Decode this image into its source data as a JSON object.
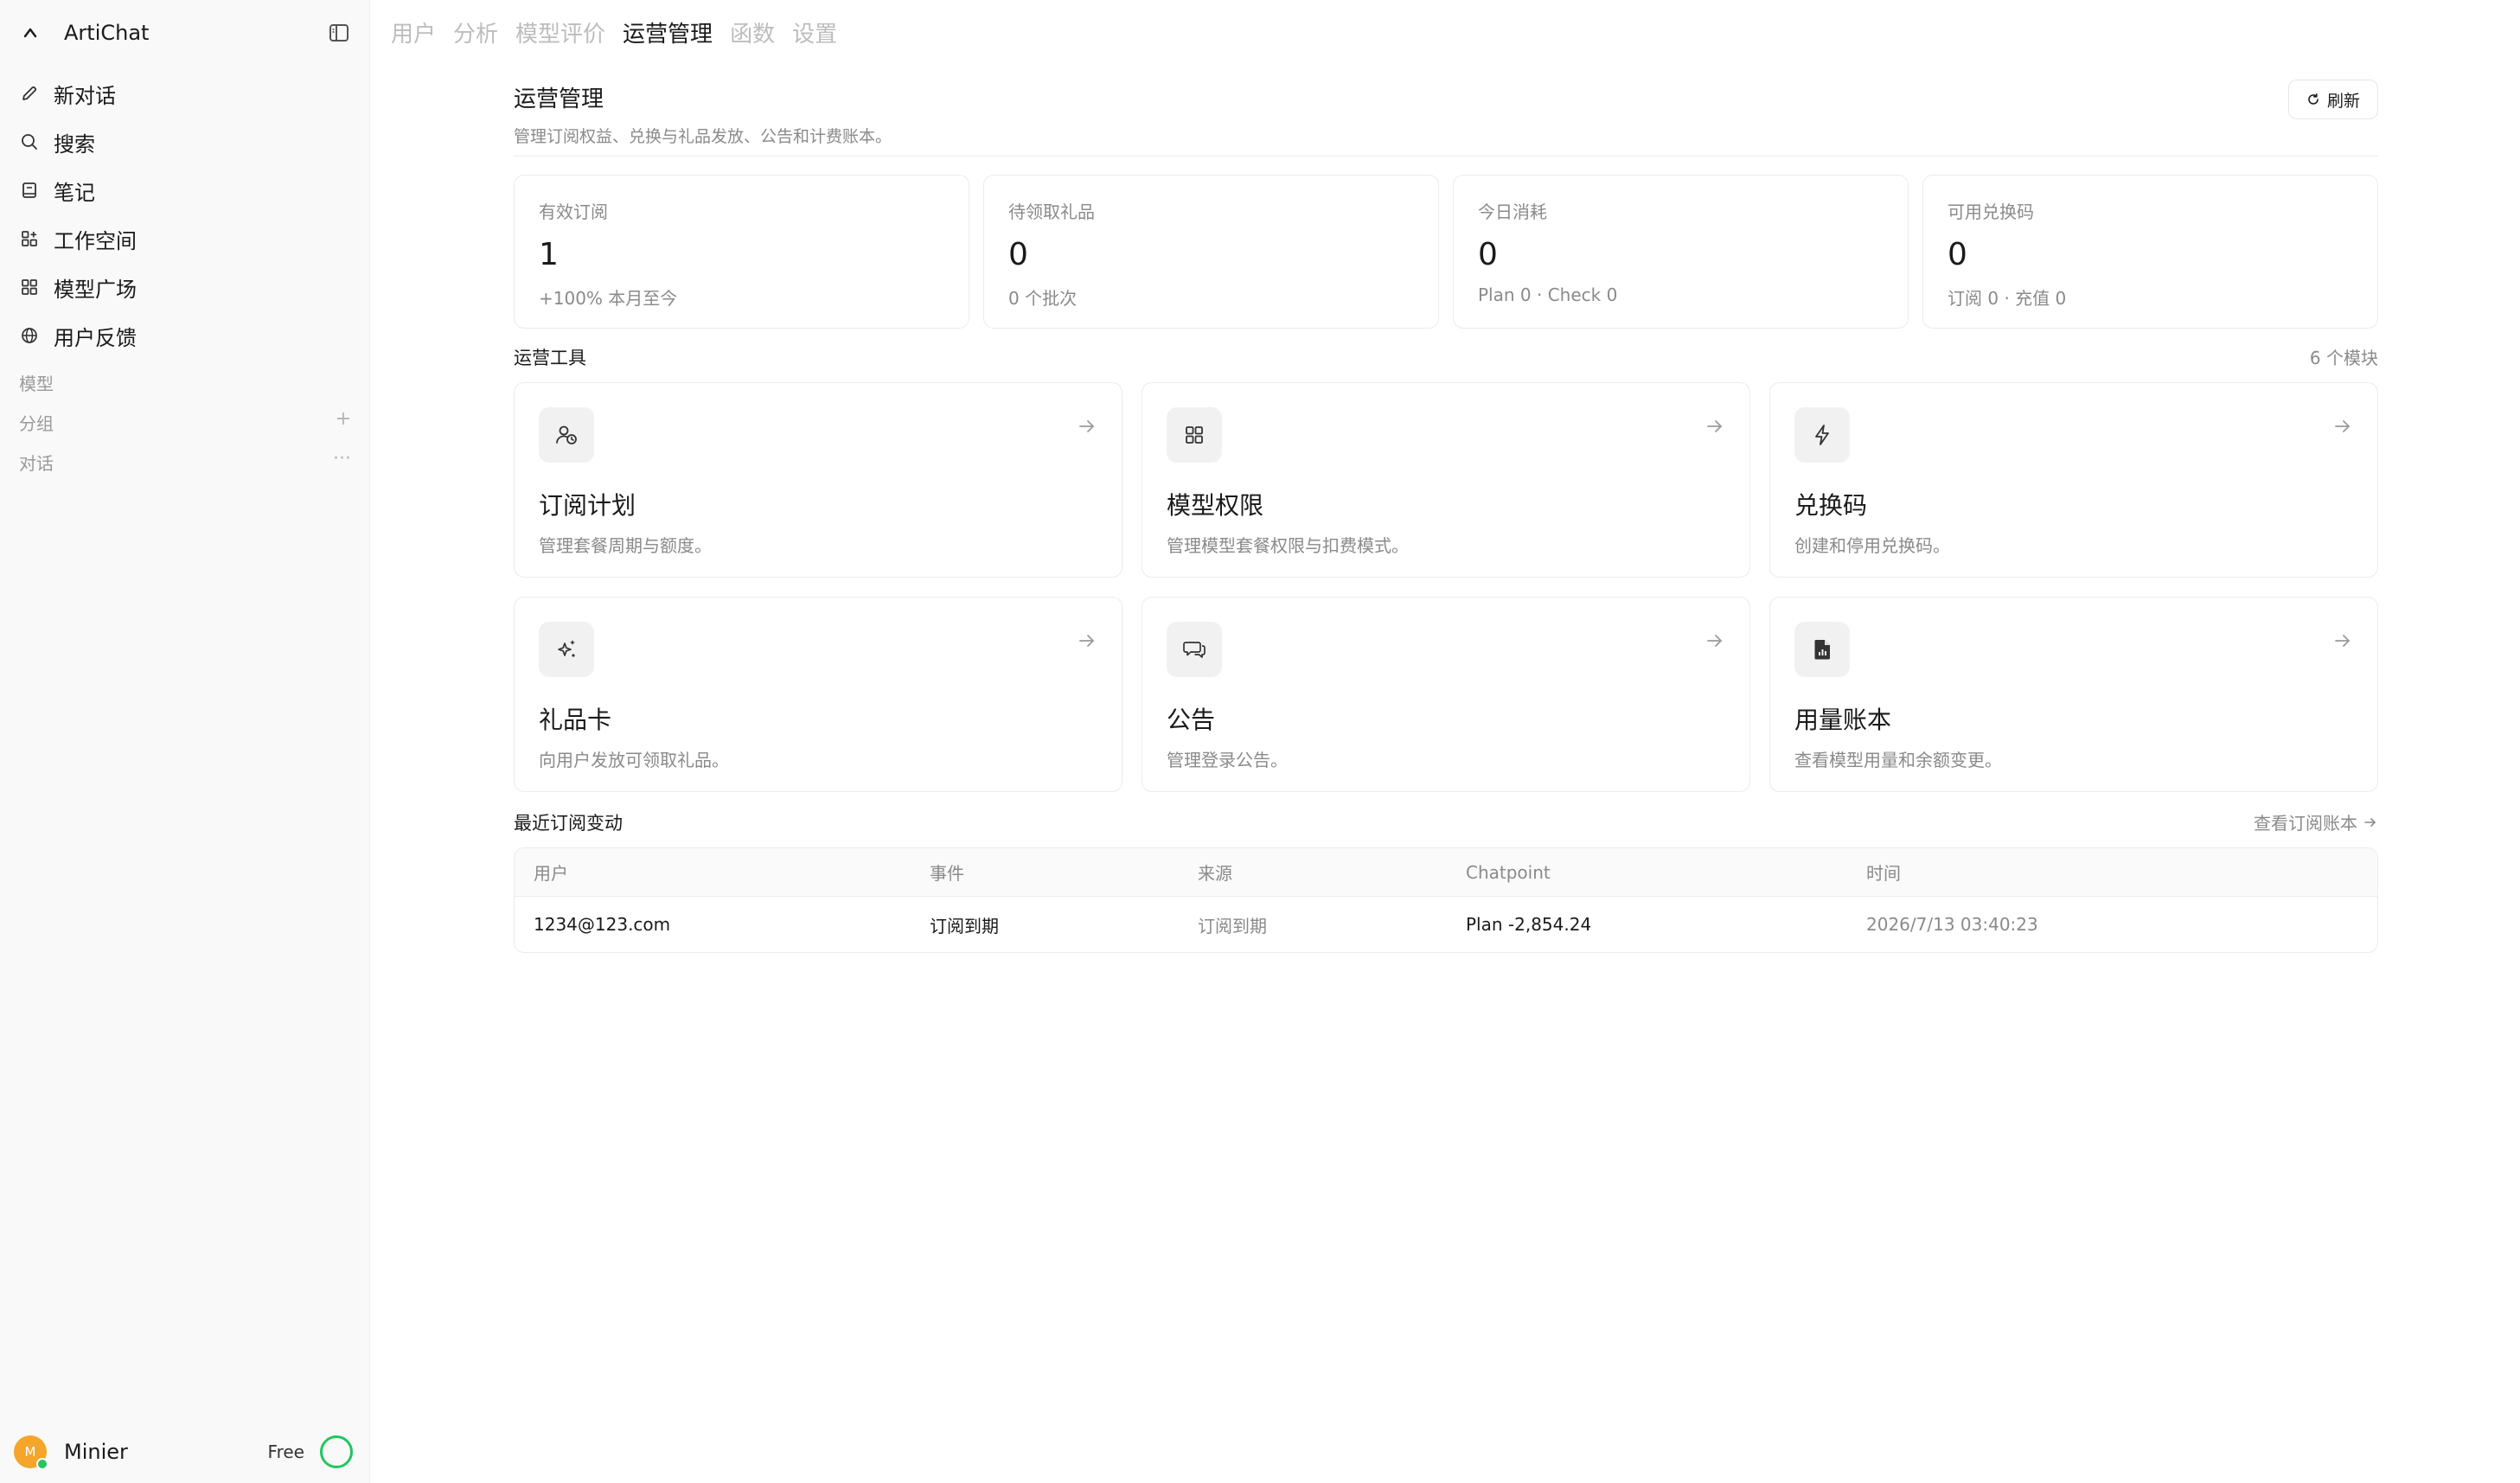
{
  "app": {
    "name": "ArtiChat"
  },
  "sidebar": {
    "items": [
      {
        "label": "新对话",
        "icon": "pencil-icon"
      },
      {
        "label": "搜索",
        "icon": "search-icon"
      },
      {
        "label": "笔记",
        "icon": "notebook-icon"
      },
      {
        "label": "工作空间",
        "icon": "workspace-icon"
      },
      {
        "label": "模型广场",
        "icon": "grid-icon"
      },
      {
        "label": "用户反馈",
        "icon": "globe-icon"
      }
    ],
    "sections": {
      "models": "模型",
      "groups": "分组",
      "groups_action": "+",
      "chats": "对话",
      "chats_action": "···"
    },
    "user": {
      "initial": "M",
      "name": "Minier",
      "plan": "Free"
    }
  },
  "tabs": [
    "用户",
    "分析",
    "模型评价",
    "运营管理",
    "函数",
    "设置"
  ],
  "active_tab": "运营管理",
  "page": {
    "title": "运营管理",
    "subtitle": "管理订阅权益、兑换与礼品发放、公告和计费账本。",
    "refresh_label": "刷新"
  },
  "stats": [
    {
      "label": "有效订阅",
      "value": "1",
      "note": "+100% 本月至今"
    },
    {
      "label": "待领取礼品",
      "value": "0",
      "note": "0 个批次"
    },
    {
      "label": "今日消耗",
      "value": "0",
      "note": "Plan 0 · Check 0"
    },
    {
      "label": "可用兑换码",
      "value": "0",
      "note": "订阅 0 · 充值 0"
    }
  ],
  "tools": {
    "title": "运营工具",
    "count": "6 个模块",
    "items": [
      {
        "name": "订阅计划",
        "desc": "管理套餐周期与额度。",
        "icon": "user-clock-icon"
      },
      {
        "name": "模型权限",
        "desc": "管理模型套餐权限与扣费模式。",
        "icon": "grid-icon"
      },
      {
        "name": "兑换码",
        "desc": "创建和停用兑换码。",
        "icon": "lightning-icon"
      },
      {
        "name": "礼品卡",
        "desc": "向用户发放可领取礼品。",
        "icon": "sparkles-icon"
      },
      {
        "name": "公告",
        "desc": "管理登录公告。",
        "icon": "chat-bubbles-icon"
      },
      {
        "name": "用量账本",
        "desc": "查看模型用量和余额变更。",
        "icon": "document-chart-icon"
      }
    ]
  },
  "recent": {
    "title": "最近订阅变动",
    "link_label": "查看订阅账本",
    "columns": [
      "用户",
      "事件",
      "来源",
      "Chatpoint",
      "时间"
    ],
    "rows": [
      {
        "user": "1234@123.com",
        "event": "订阅到期",
        "source": "订阅到期",
        "chatpoint": "Plan -2,854.24",
        "time": "2026/7/13 03:40:23"
      }
    ]
  }
}
